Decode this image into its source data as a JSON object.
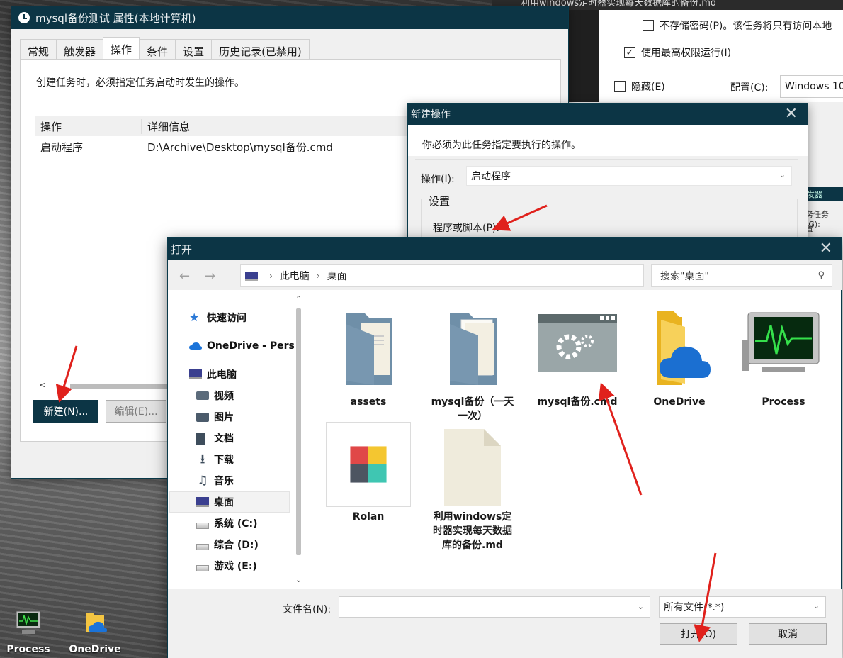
{
  "desktop": {
    "icons": [
      {
        "label": "Process"
      },
      {
        "label": "OneDrive"
      }
    ]
  },
  "bg_window": {
    "title": "利用windows定时器实现每天数据库的备份.md",
    "checkbox_no_store_password": "不存储密码(P)。该任务将只有访问本地",
    "checkbox_highest_privilege": "使用最高权限运行(I)",
    "checkbox_hidden": "隐藏(E)",
    "config_label": "配置(C):",
    "config_value": "Windows 10",
    "side_text_1": "发器",
    "side_text_2": "务任务(G):",
    "side_text_3": "置"
  },
  "props": {
    "title": "mysql备份测试 属性(本地计算机)",
    "tabs": [
      "常规",
      "触发器",
      "操作",
      "条件",
      "设置",
      "历史记录(已禁用)"
    ],
    "description": "创建任务时，必须指定任务启动时发生的操作。",
    "columns": [
      "操作",
      "详细信息"
    ],
    "rows": [
      {
        "action": "启动程序",
        "detail": "D:\\Archive\\Desktop\\mysql备份.cmd"
      }
    ],
    "new_button": "新建(N)...",
    "edit_button": "编辑(E)..."
  },
  "new_action": {
    "title": "新建操作",
    "instruction": "你必须为此任务指定要执行的操作。",
    "action_label": "操作(I):",
    "action_value": "启动程序",
    "settings_group": "设置",
    "program_label": "程序或脚本(P):"
  },
  "open_dialog": {
    "title": "打开",
    "breadcrumb": [
      "此电脑",
      "桌面"
    ],
    "search_placeholder": "搜索\"桌面\"",
    "tree": [
      {
        "label": "快速访问",
        "icon": "star-icon"
      },
      {
        "label": "OneDrive - Pers",
        "icon": "cloud-icon"
      },
      {
        "label": "此电脑",
        "icon": "computer-icon"
      },
      {
        "label": "视频",
        "icon": "video-icon"
      },
      {
        "label": "图片",
        "icon": "picture-icon"
      },
      {
        "label": "文档",
        "icon": "document-icon"
      },
      {
        "label": "下载",
        "icon": "download-icon"
      },
      {
        "label": "音乐",
        "icon": "music-icon"
      },
      {
        "label": "桌面",
        "icon": "desktop-icon"
      },
      {
        "label": "系统 (C:)",
        "icon": "drive-icon"
      },
      {
        "label": "综合 (D:)",
        "icon": "drive-icon"
      },
      {
        "label": "游戏 (E:)",
        "icon": "drive-icon"
      }
    ],
    "files": [
      {
        "label": "assets",
        "icon": "folder-icon"
      },
      {
        "label": "mysql备份（一天一次）",
        "icon": "folder-icon"
      },
      {
        "label": "mysql备份.cmd",
        "icon": "cmd-file-icon"
      },
      {
        "label": "OneDrive",
        "icon": "onedrive-folder-icon"
      },
      {
        "label": "Process",
        "icon": "process-monitor-icon"
      },
      {
        "label": "Rolan",
        "icon": "rolan-app-icon"
      },
      {
        "label": "利用windows定时器实现每天数据库的备份.md",
        "icon": "blank-file-icon"
      }
    ],
    "filename_label": "文件名(N):",
    "filename_value": "",
    "filetype_value": "所有文件(*.*)",
    "open_button": "打开(O)",
    "cancel_button": "取消"
  },
  "colors": {
    "titlebar": "#0c3545",
    "annotation_arrow": "#e0211c"
  }
}
